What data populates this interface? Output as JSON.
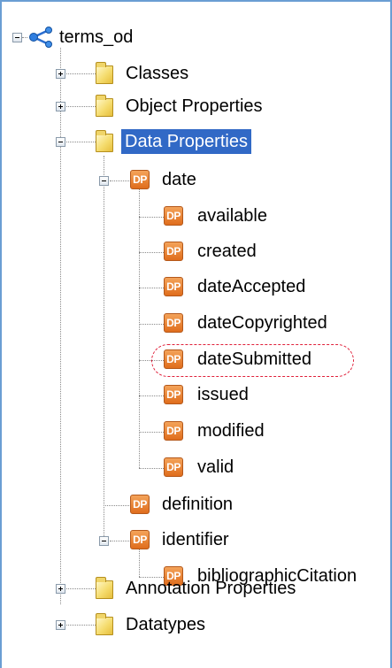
{
  "tree": {
    "root": {
      "label": "terms_od",
      "icon": "ontology-icon",
      "expander": "minus"
    },
    "folders": [
      {
        "label": "Classes",
        "icon": "folder-icon",
        "expander": "plus"
      },
      {
        "label": "Object Properties",
        "icon": "folder-icon",
        "expander": "plus"
      },
      {
        "label": "Data Properties",
        "icon": "folder-icon",
        "expander": "minus",
        "selected": true
      },
      {
        "label": "Annotation Properties",
        "icon": "folder-icon",
        "expander": "plus"
      },
      {
        "label": "Datatypes",
        "icon": "folder-icon",
        "expander": "plus"
      }
    ],
    "data_properties": {
      "date": {
        "label": "date",
        "icon_text": "DP",
        "expander": "minus",
        "children": [
          "available",
          "created",
          "dateAccepted",
          "dateCopyrighted",
          "dateSubmitted",
          "issued",
          "modified",
          "valid"
        ]
      },
      "definition": {
        "label": "definition",
        "icon_text": "DP"
      },
      "identifier": {
        "label": "identifier",
        "icon_text": "DP",
        "expander": "minus",
        "children": [
          "bibliographicCitation"
        ]
      }
    },
    "highlighted_item": "dateSubmitted"
  },
  "colors": {
    "selection_bg": "#3169c6",
    "highlight_stroke": "#e0203a",
    "panel_border": "#6a9ed3",
    "dp_icon": "#e97f2e",
    "folder": "#f2d46a"
  }
}
